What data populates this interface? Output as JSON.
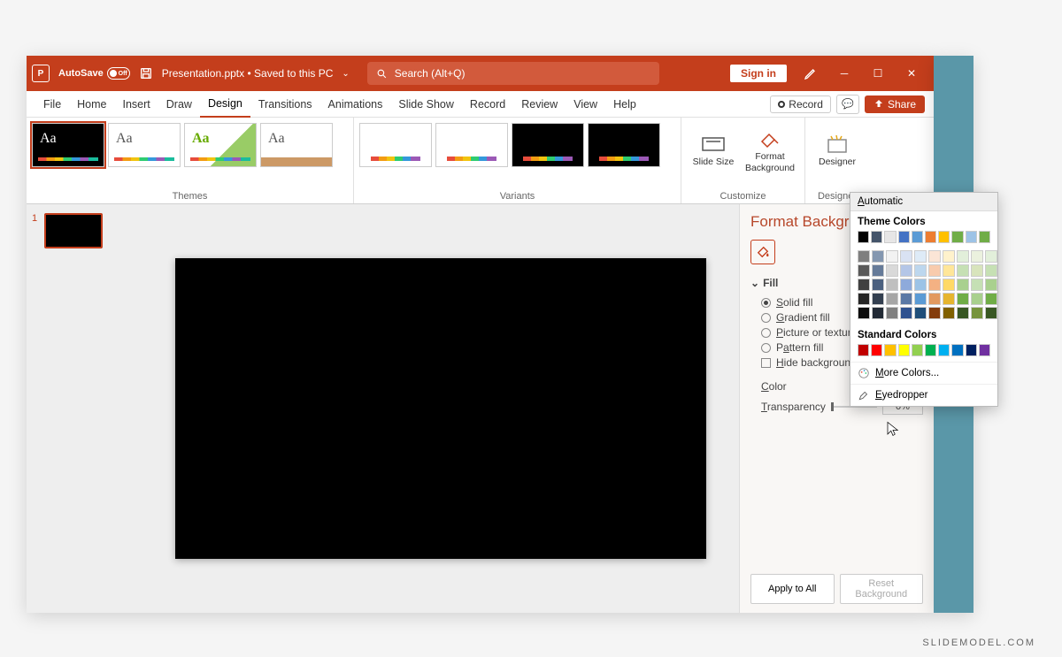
{
  "titlebar": {
    "autosave_label": "AutoSave",
    "autosave_state": "Off",
    "doc_title": "Presentation.pptx • Saved to this PC",
    "search_placeholder": "Search (Alt+Q)",
    "signin_label": "Sign in"
  },
  "menu": {
    "items": [
      "File",
      "Home",
      "Insert",
      "Draw",
      "Design",
      "Transitions",
      "Animations",
      "Slide Show",
      "Record",
      "Review",
      "View",
      "Help"
    ],
    "active_index": 4,
    "record_label": "Record",
    "share_label": "Share"
  },
  "ribbon": {
    "themes_label": "Themes",
    "variants_label": "Variants",
    "customize_label": "Customize",
    "designer_label": "Designer",
    "slide_size_label": "Slide Size",
    "format_bg_label": "Format Background",
    "designer_btn_label": "Designer"
  },
  "thumbnails": {
    "slide1_num": "1"
  },
  "sidepane": {
    "title": "Format Background",
    "section_fill": "Fill",
    "opt_solid": "Solid fill",
    "opt_gradient": "Gradient fill",
    "opt_picture": "Picture or texture fill",
    "opt_pattern": "Pattern fill",
    "chk_hide": "Hide background graphics",
    "color_label": "Color",
    "transparency_label": "Transparency",
    "transparency_value": "0%",
    "apply_all": "Apply to All",
    "reset": "Reset Background"
  },
  "colorpicker": {
    "automatic": "Automatic",
    "theme_label": "Theme Colors",
    "theme_row": [
      "#000000",
      "#44546a",
      "#e7e6e6",
      "#4472c4",
      "#5b9bd5",
      "#ed7d31",
      "#ffc000",
      "#70ad47",
      "#9dc3e6",
      "#70ad47"
    ],
    "shade_grid": [
      [
        "#7f7f7f",
        "#8497b0",
        "#f2f2f2",
        "#d9e2f3",
        "#deebf7",
        "#fbe5d6",
        "#fff2cc",
        "#e2efda",
        "#ebf1de",
        "#e2efda"
      ],
      [
        "#595959",
        "#667b99",
        "#d9d9d9",
        "#b4c6e7",
        "#bdd7ee",
        "#f8cbad",
        "#ffe699",
        "#c6e0b4",
        "#d8e4bc",
        "#c6e0b4"
      ],
      [
        "#404040",
        "#4c6180",
        "#bfbfbf",
        "#8eaadb",
        "#9cc3e6",
        "#f4b183",
        "#ffd966",
        "#a9d08e",
        "#c5e0b4",
        "#a9d08e"
      ],
      [
        "#262626",
        "#333f50",
        "#a6a6a6",
        "#5b79a5",
        "#5b9bd5",
        "#e2995f",
        "#e6b52f",
        "#70ad47",
        "#a9d08e",
        "#70ad47"
      ],
      [
        "#0d0d0d",
        "#222a35",
        "#808080",
        "#2f528f",
        "#1f4e79",
        "#843c0c",
        "#806000",
        "#385723",
        "#76933c",
        "#385723"
      ]
    ],
    "standard_label": "Standard Colors",
    "standard_row": [
      "#c00000",
      "#ff0000",
      "#ffc000",
      "#ffff00",
      "#92d050",
      "#00b050",
      "#00b0f0",
      "#0070c0",
      "#002060",
      "#7030a0"
    ],
    "more_colors": "More Colors...",
    "eyedropper": "Eyedropper"
  },
  "watermark": "SLIDEMODEL.COM"
}
